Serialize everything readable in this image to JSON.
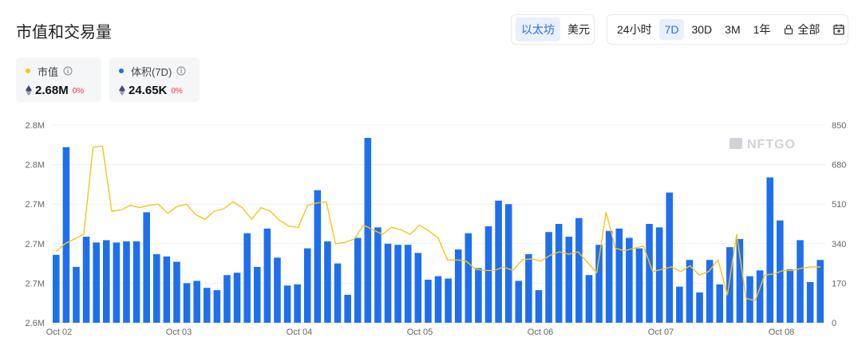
{
  "header": {
    "title": "市值和交易量"
  },
  "currency_toggle": {
    "options": [
      "以太坊",
      "美元"
    ],
    "active": 0
  },
  "range_toggle": {
    "options": [
      "24小时",
      "7D",
      "30D",
      "3M",
      "1年",
      "全部"
    ],
    "active": 1
  },
  "stats": [
    {
      "label": "市值",
      "value": "2.68M",
      "change": "0%",
      "color": "#f5c518"
    },
    {
      "label": "体积(7D)",
      "value": "24.65K",
      "change": "0%",
      "color": "#1f6fed"
    }
  ],
  "watermark": "NFTGO",
  "chart_data": {
    "type": "bar",
    "title": "",
    "xlabel": "",
    "ylabel": "",
    "x_ticks": [
      "Oct 02",
      "Oct 03",
      "Oct 04",
      "Oct 05",
      "Oct 06",
      "Oct 07",
      "Oct 08"
    ],
    "y_left_ticks": [
      "2.6M",
      "2.7M",
      "2.7M",
      "2.7M",
      "2.8M",
      "2.8M"
    ],
    "y_right_ticks": [
      "0",
      "170",
      "340",
      "510",
      "680",
      "850"
    ],
    "y_right_range": [
      0,
      850
    ],
    "y_left_range": [
      0,
      850
    ],
    "grid": true,
    "series": [
      {
        "name": "体积(7D)",
        "kind": "bar",
        "axis": "right",
        "color": "#1f6fed",
        "values": [
          292,
          755,
          240,
          370,
          345,
          355,
          345,
          350,
          350,
          475,
          295,
          285,
          262,
          170,
          180,
          150,
          140,
          205,
          215,
          385,
          240,
          405,
          280,
          160,
          165,
          320,
          570,
          350,
          255,
          120,
          365,
          795,
          410,
          340,
          335,
          335,
          300,
          185,
          200,
          190,
          315,
          385,
          235,
          415,
          525,
          510,
          180,
          295,
          140,
          390,
          425,
          370,
          450,
          205,
          335,
          395,
          405,
          365,
          320,
          425,
          410,
          560,
          155,
          270,
          130,
          270,
          165,
          325,
          360,
          200,
          225,
          625,
          440,
          230,
          355,
          175,
          270
        ]
      },
      {
        "name": "市值",
        "kind": "line",
        "axis": "left",
        "color": "#f5c518",
        "values": [
          305,
          340,
          360,
          380,
          755,
          760,
          480,
          485,
          505,
          495,
          505,
          510,
          470,
          500,
          510,
          465,
          445,
          480,
          490,
          520,
          495,
          445,
          495,
          480,
          440,
          415,
          410,
          505,
          515,
          520,
          340,
          345,
          360,
          420,
          400,
          380,
          410,
          400,
          380,
          420,
          395,
          365,
          270,
          270,
          265,
          230,
          225,
          225,
          240,
          225,
          270,
          275,
          265,
          290,
          305,
          295,
          305,
          260,
          215,
          475,
          320,
          310,
          320,
          330,
          220,
          230,
          240,
          220,
          245,
          205,
          220,
          270,
          120,
          380,
          105,
          95,
          205,
          210,
          225,
          225,
          235,
          240,
          240
        ]
      }
    ]
  }
}
